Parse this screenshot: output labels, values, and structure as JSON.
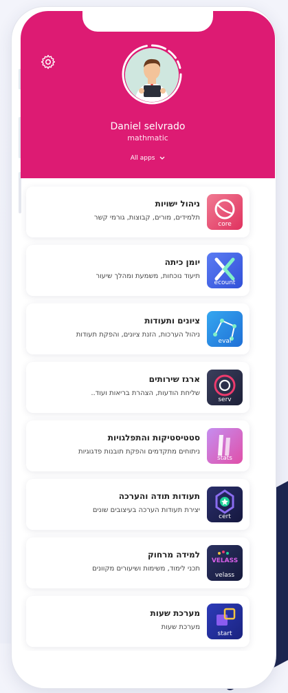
{
  "profile": {
    "name": "Daniel selvrado",
    "role": "mathmatic",
    "all_apps_label": "All apps",
    "chevron": "chevron-down-icon"
  },
  "colors": {
    "header": "#dd1b73",
    "background": "#f3f4fb",
    "deco": "#1d2650"
  },
  "apps": [
    {
      "title": "ניהול ישויות",
      "desc": "תלמידים, מורים, קבוצות, גורמי קשר",
      "icon_label": "core",
      "icon": "core-app-icon"
    },
    {
      "title": "יומן כיתה",
      "desc": "תיעוד נוכחות, משמעת ומהלך שיעור",
      "icon_label": "ecount",
      "icon": "ecount-app-icon"
    },
    {
      "title": "ציונים ותעודות",
      "desc": "ניהול הערכות, הזנת ציונים, והפקת תעודות",
      "icon_label": "eval",
      "icon": "eval-app-icon"
    },
    {
      "title": "ארגז שירותים",
      "desc": "שליחת הודעות, הצהרת בריאות ועוד..",
      "icon_label": "serv",
      "icon": "serv-app-icon"
    },
    {
      "title": "סטטיסטיקות והתפלגויות",
      "desc": "ניתוחים מתקדמים והפקת תובנות פדגוגיות",
      "icon_label": "stats",
      "icon": "stats-app-icon"
    },
    {
      "title": "תעודות תודה והערכה",
      "desc": "יצירת תעודות הערכה בעיצובים שונים",
      "icon_label": "cert",
      "icon": "cert-app-icon"
    },
    {
      "title": "למידה מרחוק",
      "desc": "תכני לימוד, משימות ושיעורים מקוונים",
      "icon_label": "velass",
      "icon_badge": "VELASS",
      "icon": "vclass-app-icon"
    },
    {
      "title": "מערכת שעות",
      "desc": "מערכת שעות",
      "icon_label": "start",
      "icon": "start-app-icon"
    }
  ]
}
